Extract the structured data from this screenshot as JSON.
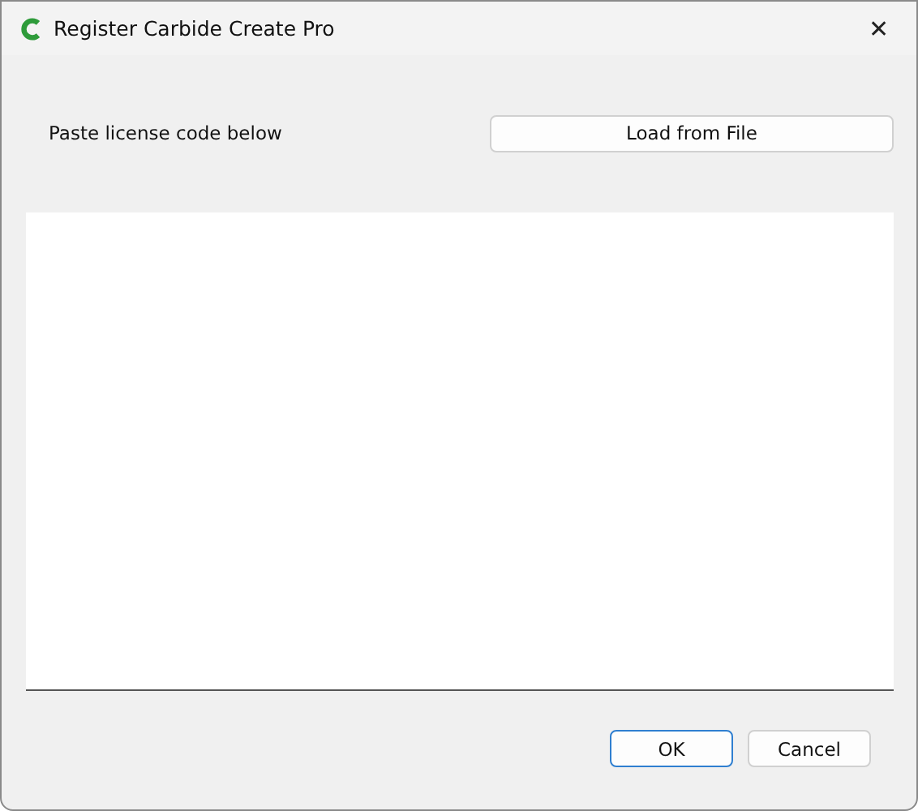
{
  "window": {
    "title": "Register Carbide Create Pro",
    "close": "✕"
  },
  "prompt": "Paste license code below",
  "load_button": "Load from File",
  "buttons": [
    {
      "label": "OK",
      "default": true
    },
    {
      "label": "Cancel",
      "default": false
    }
  ]
}
